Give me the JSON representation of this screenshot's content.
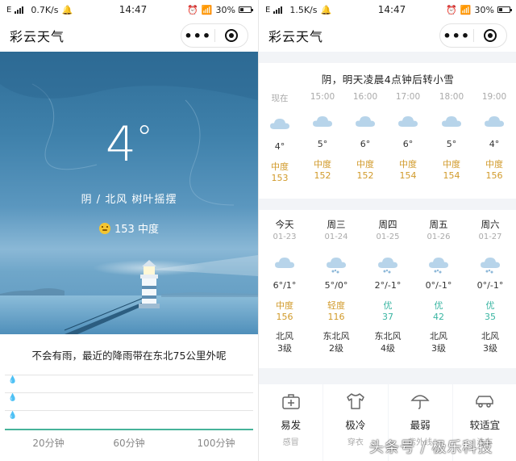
{
  "left": {
    "status": {
      "speed": "0.7K/s",
      "time": "14:47",
      "battery": "30%"
    },
    "nav_title": "彩云天气",
    "capsule": {
      "more": "•••"
    },
    "temperature": "4",
    "degree": "°",
    "condition": "阴 / 北风 树叶摇摆",
    "aqi_text": "153 中度",
    "rain_message": "不会有雨，最近的降雨带在东北75公里外呢",
    "rain_chart": {
      "type": "area",
      "x_ticks": [
        "20分钟",
        "60分钟",
        "100分钟"
      ],
      "values": [
        0,
        0,
        0,
        0,
        0,
        0,
        0,
        0,
        0,
        0,
        0,
        0
      ]
    }
  },
  "right": {
    "status": {
      "speed": "1.5K/s",
      "time": "14:47",
      "battery": "30%"
    },
    "nav_title": "彩云天气",
    "capsule": {
      "more": "•••"
    },
    "hourly_summary": "阴，明天凌晨4点钟后转小雪",
    "hourly": [
      {
        "time": "现在",
        "temp": "4°",
        "aqi_level": "中度",
        "aqi": "153"
      },
      {
        "time": "15:00",
        "temp": "5°",
        "aqi_level": "中度",
        "aqi": "152"
      },
      {
        "time": "16:00",
        "temp": "6°",
        "aqi_level": "中度",
        "aqi": "152"
      },
      {
        "time": "17:00",
        "temp": "6°",
        "aqi_level": "中度",
        "aqi": "154"
      },
      {
        "time": "18:00",
        "temp": "5°",
        "aqi_level": "中度",
        "aqi": "154"
      },
      {
        "time": "19:00",
        "temp": "4°",
        "aqi_level": "中度",
        "aqi": "156"
      }
    ],
    "daily": [
      {
        "day": "今天",
        "date": "01-23",
        "icon": "cloud-icon",
        "temp": "6°/1°",
        "aqi_level": "中度",
        "aqi": "156",
        "aqi_color": "#d19a2a",
        "wind": "北风",
        "wind_level": "3级"
      },
      {
        "day": "周三",
        "date": "01-24",
        "icon": "snow-cloud-icon",
        "temp": "5°/0°",
        "aqi_level": "轻度",
        "aqi": "116",
        "aqi_color": "#d19a2a",
        "wind": "东北风",
        "wind_level": "2级"
      },
      {
        "day": "周四",
        "date": "01-25",
        "icon": "snow-cloud-icon",
        "temp": "2°/-1°",
        "aqi_level": "优",
        "aqi": "37",
        "aqi_color": "#3ab5a2",
        "wind": "东北风",
        "wind_level": "4级"
      },
      {
        "day": "周五",
        "date": "01-26",
        "icon": "snow-cloud-icon",
        "temp": "0°/-1°",
        "aqi_level": "优",
        "aqi": "42",
        "aqi_color": "#3ab5a2",
        "wind": "北风",
        "wind_level": "3级"
      },
      {
        "day": "周六",
        "date": "01-27",
        "icon": "snow-cloud-icon",
        "temp": "0°/-1°",
        "aqi_level": "优",
        "aqi": "35",
        "aqi_color": "#3ab5a2",
        "wind": "北风",
        "wind_level": "3级"
      }
    ],
    "life": [
      {
        "icon": "medical-kit-icon",
        "value": "易发",
        "name": "感冒"
      },
      {
        "icon": "clothing-icon",
        "value": "极冷",
        "name": "穿衣"
      },
      {
        "icon": "umbrella-icon",
        "value": "最弱",
        "name": "紫外线"
      },
      {
        "icon": "car-icon",
        "value": "较适宜",
        "name": "洗车"
      }
    ]
  },
  "watermark": "头条号 / 极乐科技",
  "colors": {
    "aqi_moderate": "#d19a2a",
    "aqi_good": "#3ab5a2",
    "accent_green": "#46b39a"
  }
}
